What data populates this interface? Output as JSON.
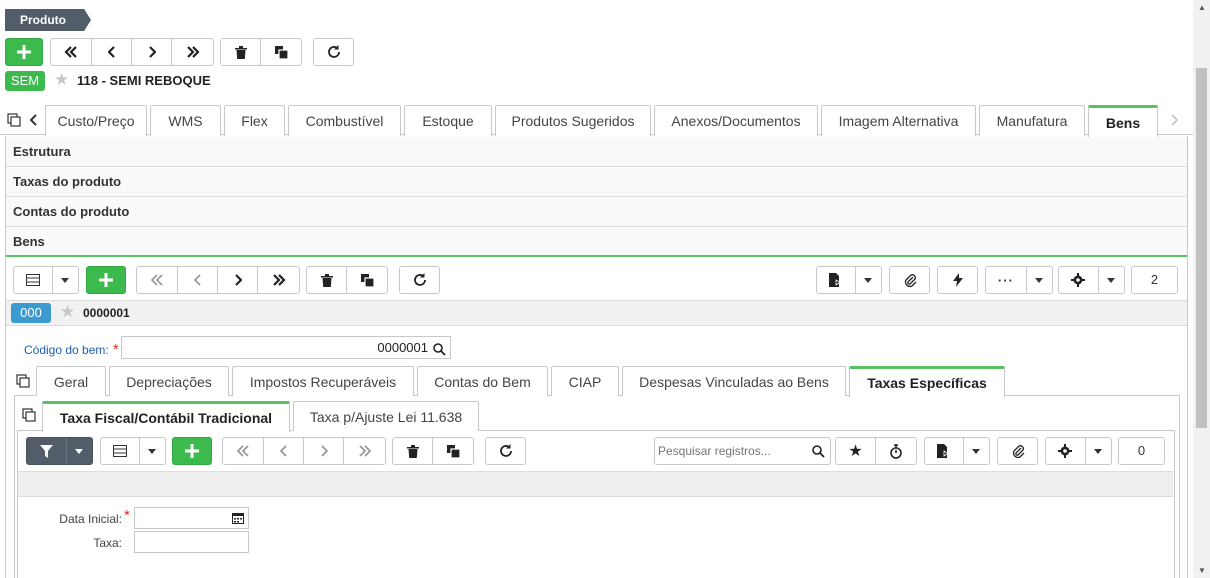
{
  "breadcrumb": {
    "label": "Produto"
  },
  "record": {
    "badge": "SEM",
    "title": "118 - SEMI REBOQUE"
  },
  "main_tabs": [
    "Custo/Preço",
    "WMS",
    "Flex",
    "Combustível",
    "Estoque",
    "Produtos Sugeridos",
    "Anexos/Documentos",
    "Imagem Alternativa",
    "Manufatura",
    "Bens"
  ],
  "sections": [
    "Estrutura",
    "Taxas do produto",
    "Contas do produto",
    "Bens"
  ],
  "bens": {
    "counter": "2",
    "badge": "000",
    "code": "0000001",
    "codigo_label": "Código do bem:",
    "codigo_value": "0000001"
  },
  "sub_tabs": [
    "Geral",
    "Depreciações",
    "Impostos Recuperáveis",
    "Contas do Bem",
    "CIAP",
    "Despesas Vinculadas ao Bens",
    "Taxas Específicas"
  ],
  "inner_tabs": [
    "Taxa Fiscal/Contábil Tradicional",
    "Taxa p/Ajuste Lei 11.638"
  ],
  "grid": {
    "search_placeholder": "Pesquisar registros...",
    "counter": "0"
  },
  "form": {
    "data_inicial_label": "Data Inicial:",
    "taxa_label": "Taxa:"
  },
  "colors": {
    "accent": "#56c264",
    "green": "#3dba4e",
    "dark": "#535c69",
    "blue_badge": "#3b9bd1"
  }
}
